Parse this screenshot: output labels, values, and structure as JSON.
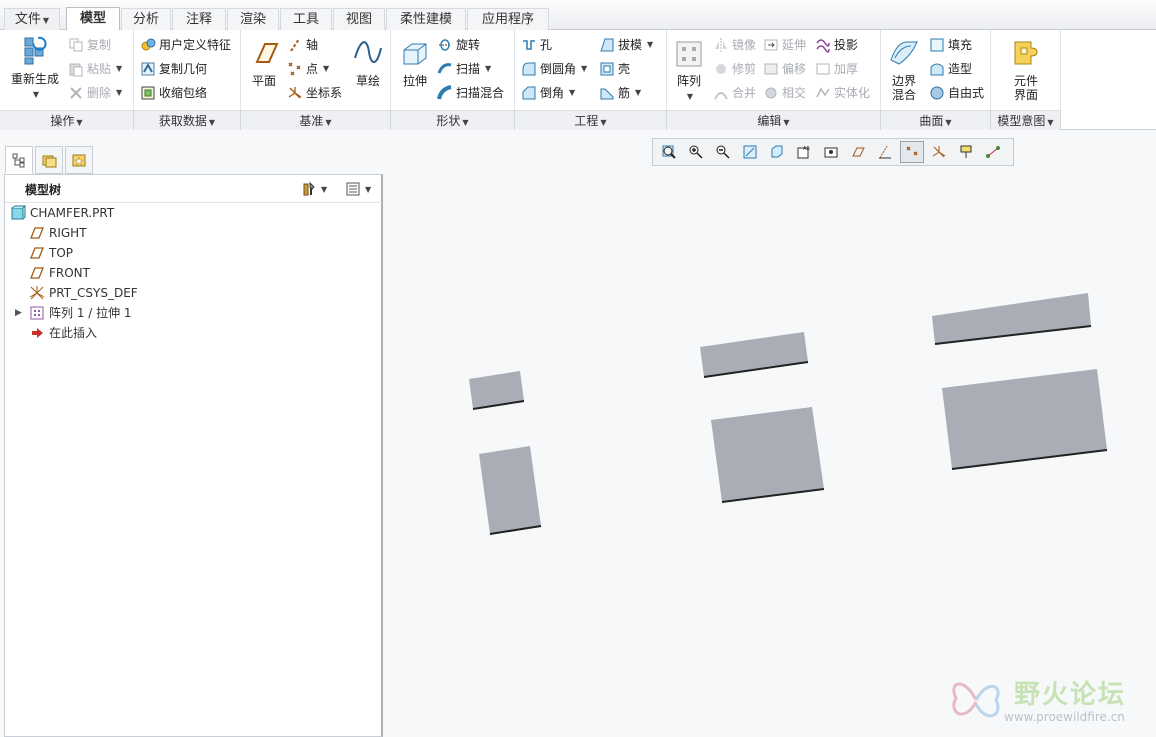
{
  "tabs": [
    {
      "label": "文件",
      "name": "tab-file"
    },
    {
      "label": "模型",
      "name": "tab-model"
    },
    {
      "label": "分析",
      "name": "tab-analysis"
    },
    {
      "label": "注释",
      "name": "tab-annotate"
    },
    {
      "label": "渲染",
      "name": "tab-render"
    },
    {
      "label": "工具",
      "name": "tab-tools"
    },
    {
      "label": "视图",
      "name": "tab-view"
    },
    {
      "label": "柔性建模",
      "name": "tab-flexible-modeling"
    },
    {
      "label": "应用程序",
      "name": "tab-applications"
    }
  ],
  "ribbon": {
    "operations": {
      "regenerate": "重新生成",
      "copy": "复制",
      "paste": "粘贴",
      "delete": "删除",
      "label": "操作"
    },
    "get_data": {
      "udf": "用户定义特征",
      "copy_geom": "复制几何",
      "shrinkwrap": "收缩包络",
      "label": "获取数据"
    },
    "datum": {
      "plane": "平面",
      "axis": "轴",
      "point": "点",
      "csys": "坐标系",
      "sketch": "草绘",
      "label": "基准"
    },
    "shapes": {
      "extrude": "拉伸",
      "revolve": "旋转",
      "sweep": "扫描",
      "swept_blend": "扫描混合",
      "label": "形状"
    },
    "engineering": {
      "hole": "孔",
      "round": "倒圆角",
      "chamfer": "倒角",
      "draft": "拔模",
      "shell": "壳",
      "rib": "筋",
      "label": "工程"
    },
    "editing": {
      "pattern": "阵列",
      "mirror": "镜像",
      "trim": "修剪",
      "merge": "合并",
      "extend": "延伸",
      "offset": "偏移",
      "intersect": "相交",
      "project": "投影",
      "thicken": "加厚",
      "solidify": "实体化",
      "label": "编辑"
    },
    "surfaces": {
      "boundary_blend": "边界混合",
      "fill": "填充",
      "style": "造型",
      "freestyle": "自由式",
      "label": "曲面"
    },
    "model_intent": {
      "component_interface": "元件界面",
      "label": "模型意图"
    }
  },
  "tree": {
    "title": "模型树",
    "items": [
      {
        "label": "CHAMFER.PRT",
        "icon": "part-icon"
      },
      {
        "label": "RIGHT",
        "icon": "datum-plane-icon"
      },
      {
        "label": "TOP",
        "icon": "datum-plane-icon"
      },
      {
        "label": "FRONT",
        "icon": "datum-plane-icon"
      },
      {
        "label": "PRT_CSYS_DEF",
        "icon": "csys-icon"
      },
      {
        "label": "阵列 1 / 拉伸 1",
        "icon": "pattern-icon"
      },
      {
        "label": "在此插入",
        "icon": "insert-here-arrow-icon"
      }
    ]
  },
  "watermark": {
    "text": "野火论坛",
    "url": "www.proewildfire.cn"
  },
  "colors": {
    "part_face": "#a9adb6",
    "accent_tab": "#ffffff",
    "wm_green": "#c7e3b6"
  }
}
